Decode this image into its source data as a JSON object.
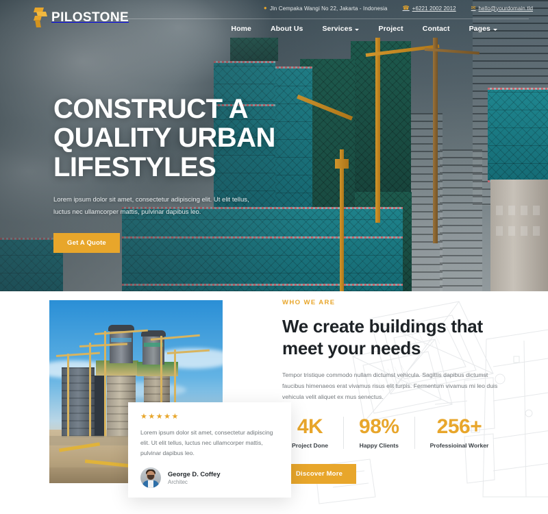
{
  "topbar": {
    "address": "Jln Cempaka Wangi No 22, Jakarta - Indonesia",
    "address_icon": "location-pin-icon",
    "phone": "+6221 2002 2012",
    "phone_icon": "phone-icon",
    "email": "hello@yourdomain.tld",
    "email_icon": "envelope-icon"
  },
  "brand": {
    "name": "PILOSTONE",
    "logo_icon": "pilostone-logo-mark"
  },
  "nav": {
    "items": [
      {
        "label": "Home",
        "has_dropdown": false
      },
      {
        "label": "About Us",
        "has_dropdown": false
      },
      {
        "label": "Services",
        "has_dropdown": true
      },
      {
        "label": "Project",
        "has_dropdown": false
      },
      {
        "label": "Contact",
        "has_dropdown": false
      },
      {
        "label": "Pages",
        "has_dropdown": true
      }
    ],
    "search_icon": "search-icon"
  },
  "hero": {
    "title_line1": "CONSTRUCT A",
    "title_line2": "QUALITY URBAN",
    "title_line3": "LIFESTYLES",
    "paragraph": "Lorem ipsum dolor sit amet, consectetur adipiscing elit. Ut elit tellus, luctus nec ullamcorper mattis, pulvinar dapibus leo.",
    "cta_label": "Get A Quote",
    "image_alt": "construction-site-skyscrapers-with-teal-safety-netting"
  },
  "about": {
    "eyebrow": "WHO WE ARE",
    "heading_line1": "We create buildings that",
    "heading_line2": "meet your needs",
    "paragraph": "Tempor tristique commodo nullam dictumst vehicula. Sagittis dapibus dictumst faucibus himenaeos erat vivamus risus elit turpis. Fermentum vivamus mi leo duis vehicula velit aliquet ex mus senectus.",
    "cta_label": "Discover More",
    "image_alt": "towers-under-construction-with-cranes",
    "stats": [
      {
        "value": "4K",
        "label": "Project Done"
      },
      {
        "value": "98%",
        "label": "Happy Clients"
      },
      {
        "value": "256+",
        "label": "Professioinal Worker"
      }
    ],
    "testimonial": {
      "rating": "★★★★★",
      "quote": "Lorem ipsum dolor sit amet, consectetur adipiscing elit. Ut elit tellus, luctus nec ullamcorper mattis, pulvinar dapibus leo.",
      "name": "George D. Coffey",
      "role": "Architec",
      "avatar_alt": "avatar-george-d-coffey"
    }
  },
  "colors": {
    "accent": "#e8a62b",
    "heading": "#1d2226",
    "body_text": "#74797d",
    "hero_overlay": "#263238",
    "netting_teal": "#1f8d96"
  }
}
